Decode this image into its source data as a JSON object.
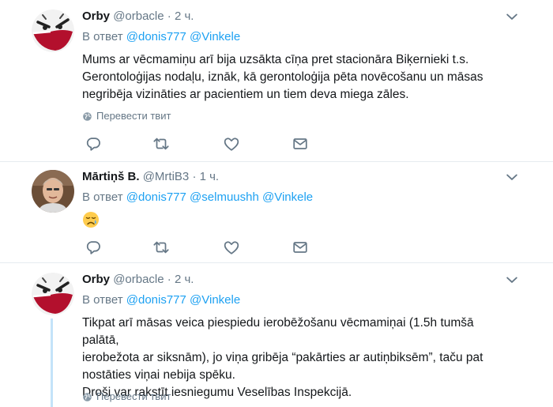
{
  "tweets": [
    {
      "name": "Orby",
      "handle": "@orbacle",
      "dot": "·",
      "time": "2 ч.",
      "replying_prefix": "В ответ",
      "mentions": [
        "@donis777",
        "@Vinkele"
      ],
      "text_lines": [
        "Mums ar vēcmamiņu arī bija uzsākta cīņa pret stacionāra Biķernieki t.s.",
        "Gerontoloģijas nodaļu, iznāk, kā gerontoloģija pēta novēcošanu un māsas",
        "negribēja vizināties ar pacientiem un tiem deva miega zāles."
      ],
      "translate_label": "Перевести твит",
      "avatar": "angry-ball-avatar"
    },
    {
      "name": "Mārtiņš B.",
      "handle": "@MrtiB3",
      "dot": "·",
      "time": "1 ч.",
      "replying_prefix": "В ответ",
      "mentions": [
        "@donis777",
        "@selmuushh",
        "@Vinkele"
      ],
      "emoji": "crying-face-emoji",
      "avatar": "man-photo-avatar"
    },
    {
      "name": "Orby",
      "handle": "@orbacle",
      "dot": "·",
      "time": "2 ч.",
      "replying_prefix": "В ответ",
      "mentions": [
        "@donis777",
        "@Vinkele"
      ],
      "text_lines": [
        "Tikpat arī māsas veica piespiedu ierobēžošanu vēcmamiņai (1.5h tumšā palātā,",
        "ierobežota ar siksnām), jo viņa gribēja “pakārties ar autiņbiksēm”, taču pat",
        "nostāties viņai nebija spēku.",
        "Droši var rakstīt iesniegumu Veselības Inspekcijā."
      ],
      "translate_label": "Перевести твит",
      "avatar": "angry-ball-avatar"
    }
  ],
  "colors": {
    "link": "#1da1f2",
    "secondary_text": "#657786",
    "divider": "#e6ecf0",
    "thread_line": "#c4e3f9",
    "avatar_red": "#b3102d"
  },
  "icons": [
    "chevron-down-icon",
    "globe-icon",
    "reply-icon",
    "retweet-icon",
    "like-icon",
    "message-icon"
  ]
}
